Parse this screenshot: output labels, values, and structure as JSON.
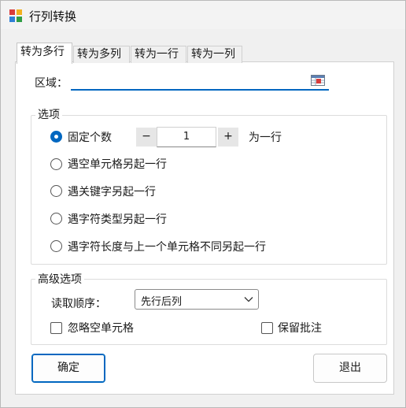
{
  "window": {
    "title": "行列转换",
    "icon": "app-grid-icon"
  },
  "tabs": [
    {
      "label": "转为多行",
      "active": true
    },
    {
      "label": "转为多列",
      "active": false
    },
    {
      "label": "转为一行",
      "active": false
    },
    {
      "label": "转为一列",
      "active": false
    }
  ],
  "range": {
    "label": "区域：",
    "value": "",
    "picker_icon": "range-select-icon"
  },
  "options": {
    "title": "选项",
    "fixed_count_label": "固定个数",
    "stepper": {
      "decrement": "−",
      "value": "1",
      "increment": "+"
    },
    "per_row_label": "为一行",
    "items": [
      {
        "label": "遇空单元格另起一行",
        "checked": false
      },
      {
        "label": "遇关键字另起一行",
        "checked": false
      },
      {
        "label": "遇字符类型另起一行",
        "checked": false
      },
      {
        "label": "遇字符长度与上一个单元格不同另起一行",
        "checked": false
      }
    ],
    "selected": "固定个数"
  },
  "advanced": {
    "title": "高级选项",
    "read_order_label": "读取顺序：",
    "read_order_value": "先行后列",
    "ignore_empty_label": "忽略空单元格",
    "keep_comments_label": "保留批注"
  },
  "buttons": {
    "ok": "确定",
    "cancel": "退出"
  },
  "colors": {
    "accent": "#0067c0",
    "panel": "#ffffff",
    "window": "#f0f0f0"
  }
}
